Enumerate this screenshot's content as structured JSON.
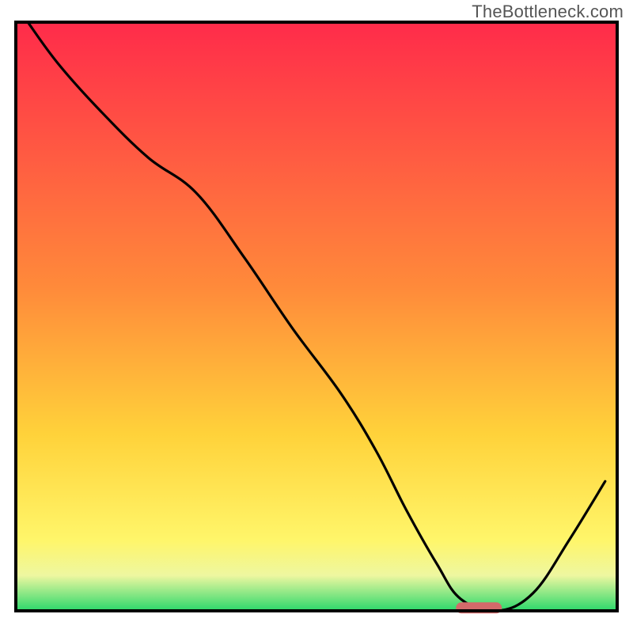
{
  "watermark": "TheBottleneck.com",
  "chart_data": {
    "type": "line",
    "title": "",
    "xlabel": "",
    "ylabel": "",
    "xlim": [
      0,
      100
    ],
    "ylim": [
      0,
      100
    ],
    "series": [
      {
        "name": "curve",
        "x": [
          2,
          7,
          14,
          22,
          30,
          38,
          46,
          54,
          60,
          65,
          70,
          74,
          80,
          86,
          92,
          98
        ],
        "values": [
          100,
          93,
          85,
          77,
          71,
          60,
          48,
          37,
          27,
          17,
          8,
          2,
          0,
          3,
          12,
          22
        ]
      }
    ],
    "marker": {
      "name": "target-marker",
      "x_center": 77,
      "y": 0.5,
      "color": "#d36a6a"
    },
    "background_gradient": {
      "top": "#ff2b4a",
      "mid_upper": "#ff8a3a",
      "mid": "#ffd23a",
      "mid_lower": "#fff66a",
      "bottom": "#2bd86b"
    },
    "frame_color": "#000000"
  }
}
